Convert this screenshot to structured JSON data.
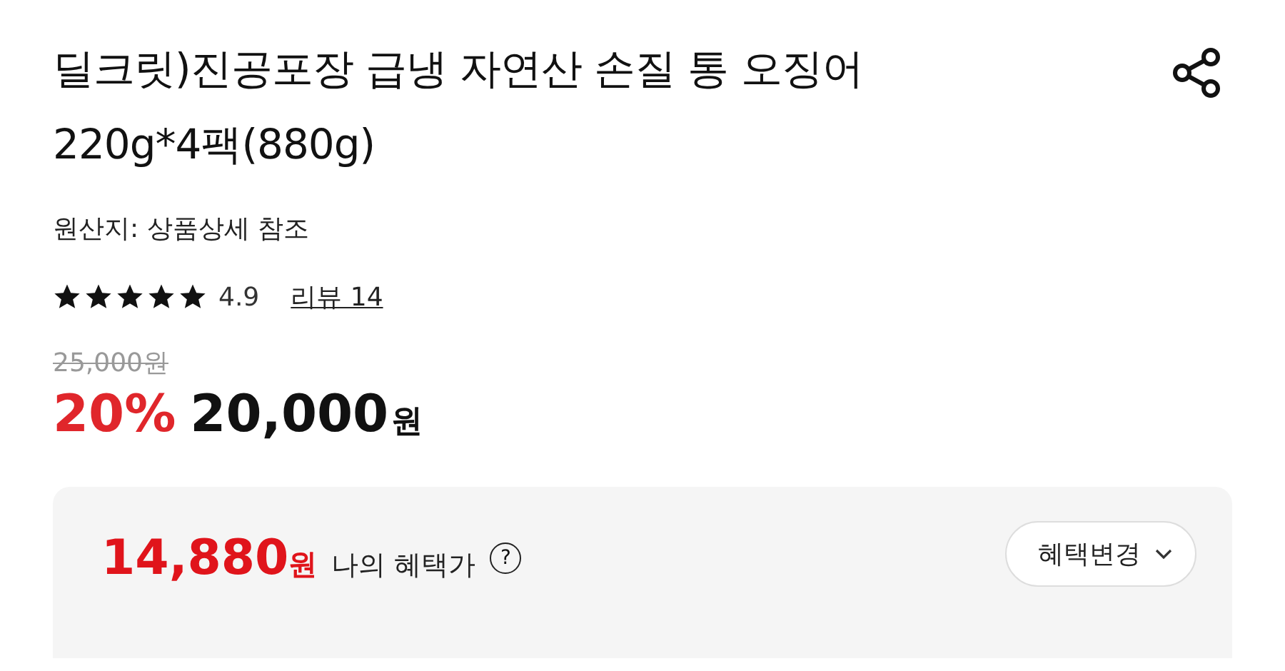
{
  "product": {
    "title_lines": [
      "딜크릿)진공포장 급냉 자연산 손질 통 오징어",
      "220g*4팩(880g)"
    ],
    "origin": "원산지: 상품상세 참조"
  },
  "rating": {
    "stars": 5,
    "score": "4.9",
    "reviews": "리뷰 14"
  },
  "price": {
    "original": "25,000원",
    "discount": "20%",
    "amount": "20,000",
    "currency": "원"
  },
  "benefit": {
    "amount": "14,880",
    "currency": "원",
    "label": "나의 혜택가",
    "help": "?",
    "button": "혜택변경"
  }
}
